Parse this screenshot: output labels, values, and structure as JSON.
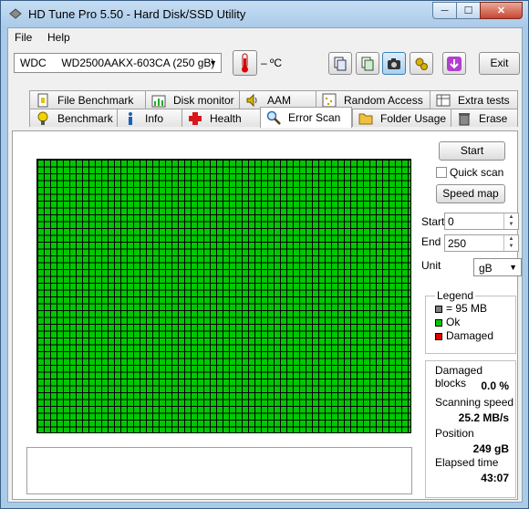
{
  "window": {
    "title": "HD Tune Pro 5.50 - Hard Disk/SSD Utility",
    "controls": {
      "minimize": "─",
      "maximize": "☐",
      "close": "✕"
    }
  },
  "menu": {
    "file": "File",
    "help": "Help"
  },
  "toolbar": {
    "drive": "WDC     WD2500AAKX-603CA (250 gB)",
    "temperature": "– ºC",
    "exit_label": "Exit"
  },
  "tabs_top": [
    {
      "label": "File Benchmark",
      "icon": "file-benchmark-icon"
    },
    {
      "label": "Disk monitor",
      "icon": "disk-monitor-icon"
    },
    {
      "label": "AAM",
      "icon": "speaker-icon"
    },
    {
      "label": "Random Access",
      "icon": "random-access-icon"
    },
    {
      "label": "Extra tests",
      "icon": "extra-tests-icon"
    }
  ],
  "tabs_bottom": [
    {
      "label": "Benchmark",
      "icon": "benchmark-icon"
    },
    {
      "label": "Info",
      "icon": "info-icon"
    },
    {
      "label": "Health",
      "icon": "health-cross-icon"
    },
    {
      "label": "Error Scan",
      "icon": "magnifier-icon"
    },
    {
      "label": "Folder Usage",
      "icon": "folder-icon"
    },
    {
      "label": "Erase",
      "icon": "trash-icon"
    }
  ],
  "scan": {
    "start_button": "Start",
    "quick_scan": "Quick scan",
    "speed_map_button": "Speed map",
    "start_label": "Start",
    "start_value": "0",
    "end_label": "End",
    "end_value": "250",
    "unit_label": "Unit",
    "unit_value": "gB",
    "grid_status": "Ok"
  },
  "legend": {
    "title": "Legend",
    "block_size": "= 95 MB",
    "ok": "Ok",
    "damaged": "Damaged",
    "colors": {
      "block": "#808080",
      "ok": "#00c800",
      "damaged": "#e00000"
    }
  },
  "stats": {
    "damaged_blocks_label": "Damaged blocks",
    "damaged_blocks_value": "0.0 %",
    "scanning_speed_label": "Scanning speed",
    "scanning_speed_value": "25.2 MB/s",
    "position_label": "Position",
    "position_value": "249 gB",
    "elapsed_label": "Elapsed time",
    "elapsed_value": "43:07"
  }
}
